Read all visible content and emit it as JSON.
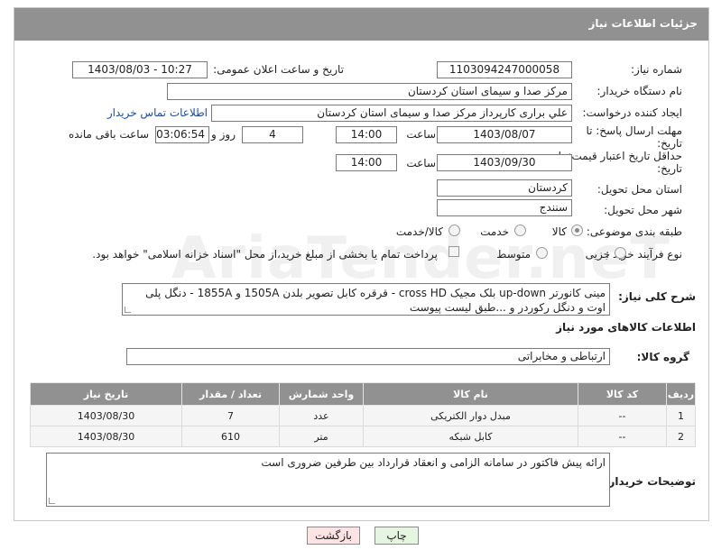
{
  "header": {
    "title": "جزئیات اطلاعات نیاز"
  },
  "form": {
    "need_number_label": "شماره نیاز:",
    "need_number": "1103094247000058",
    "announce_label": "تاریخ و ساعت اعلان عمومی:",
    "announce_value": "1403/08/03 - 10:27",
    "buyer_org_label": "نام دستگاه خریدار:",
    "buyer_org": "مرکز صدا و سیمای استان کردستان",
    "requester_label": "ایجاد کننده درخواست:",
    "requester": "علي براری کارپرداز مرکز صدا و سیمای استان کردستان",
    "contact_link": "اطلاعات تماس خریدار",
    "reply_deadline_label_1": "مهلت ارسال پاسخ: تا",
    "reply_deadline_label_2": "تاریخ:",
    "reply_date": "1403/08/07",
    "time_label": "ساعت",
    "reply_time": "14:00",
    "days_value": "4",
    "days_label": "روز و",
    "remaining_time": "03:06:54",
    "remaining_label": "ساعت باقی مانده",
    "price_validity_label_1": "حداقل تاریخ اعتبار قیمت: تا",
    "price_validity_label_2": "تاریخ:",
    "validity_date": "1403/09/30",
    "validity_time": "14:00",
    "province_label": "استان محل تحویل:",
    "province": "کردستان",
    "city_label": "شهر محل تحویل:",
    "city": "سنندج",
    "category_label": "طبقه بندی موضوعی:",
    "category_options": [
      "کالا",
      "خدمت",
      "کالا/خدمت"
    ],
    "category_selected": "کالا",
    "purchase_type_label": "نوع فرآیند خرید :",
    "purchase_options": [
      "جزیی",
      "متوسط"
    ],
    "payment_note": "پرداخت تمام یا بخشی از مبلغ خرید،از محل \"اسناد خزانه اسلامی\" خواهد بود.",
    "summary_label": "شرح کلی نیاز:",
    "summary_text": "مینی کانورتر up-down بلک مجیک cross HD - قرقره کابل تصویر بلدن 1505A و 1855A - دنگل پلی اوت و دنگل رکوردر  و ...طبق لیست پیوست"
  },
  "goods": {
    "section_title": "اطلاعات کالاهای مورد نیاز",
    "group_label": "گروه کالا:",
    "group_value": "ارتباطی و مخابراتی",
    "columns": [
      "ردیف",
      "کد کالا",
      "نام کالا",
      "واحد شمارش",
      "تعداد / مقدار",
      "تاریخ نیاز"
    ],
    "rows": [
      [
        "1",
        "--",
        "مبدل دوار الکتریکی",
        "عدد",
        "7",
        "1403/08/30"
      ],
      [
        "2",
        "--",
        "کابل شبکه",
        "متر",
        "610",
        "1403/08/30"
      ]
    ]
  },
  "buyer_notes": {
    "label": "توضیحات خریدار:",
    "text": "ارائه پیش فاکتور در سامانه الزامی و انعقاد قرارداد بین طرفین ضروری است"
  },
  "buttons": {
    "print": "چاپ",
    "back": "بازگشت"
  },
  "watermark": {
    "text": "AriaTender.neT"
  },
  "colors": {
    "header_bg": "#919191",
    "print_bg": "#e6f5e0",
    "back_bg": "#fde3e3"
  }
}
